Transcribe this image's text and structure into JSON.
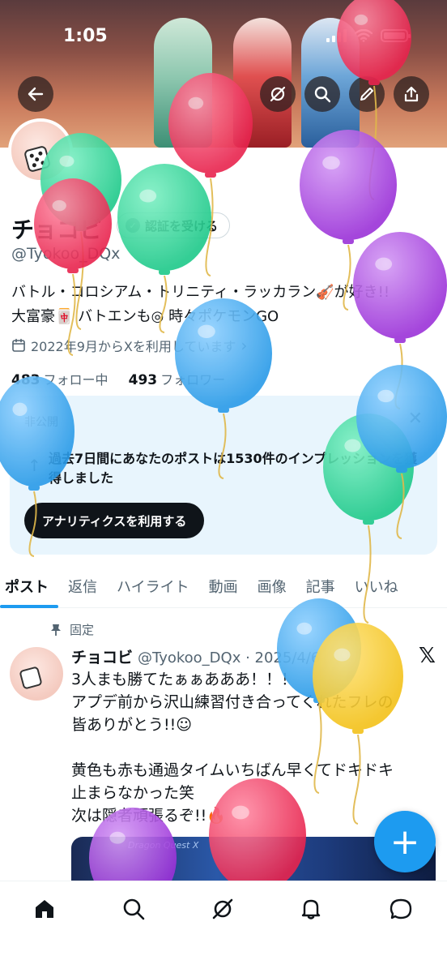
{
  "status_bar": {
    "time": "1:05"
  },
  "profile": {
    "name": "チョコビ",
    "verify_label": "認証を受ける",
    "handle": "@Tyokoo_DQx",
    "bio_line1": "バトル・コロシアム・トリニティ・ラッカラン🎻が好き!!",
    "bio_line2": "大富豪🀄 バトエンも◎ 時々ポケモンGO",
    "joined": "2022年9月からXを利用しています",
    "following_count": "483",
    "following_label": "フォロー中",
    "followers_count": "493",
    "followers_label": "フォロワー"
  },
  "analytics_card": {
    "private_label": "非公開",
    "message": "過去7日間にあなたのポストは1530件のインプレッションを獲得しました",
    "cta_label": "アナリティクスを利用する"
  },
  "tabs": [
    "ポスト",
    "返信",
    "ハイライト",
    "動画",
    "画像",
    "記事",
    "いいね"
  ],
  "tweet": {
    "pinned_label": "固定",
    "author": "チョコビ",
    "handle_date": "@Tyokoo_DQx · 2025/4/6",
    "line1": "3人まも勝てたぁぁあああ！！！",
    "line2": "アプデ前から沢山練習付き合ってくれたフレの",
    "line3": "皆ありがとう!!☺",
    "line4": "",
    "line5": "黄色も赤も通過タイムいちばん早くてドキドキ",
    "line6": "止まらなかった笑",
    "line7": "次は隠者頑張るぞ!!🔥",
    "media_title": "Dragon Quest X"
  },
  "icons": {
    "back": "back-arrow-icon",
    "grok": "grok-icon",
    "search": "search-icon",
    "edit": "edit-icon",
    "share": "share-icon",
    "calendar": "calendar-icon",
    "pin": "pin-icon",
    "x_logo": "x-logo-icon",
    "compose": "compose-plus-icon",
    "home": "home-icon",
    "explore": "search-icon",
    "grok_nav": "grok-icon",
    "notifications": "bell-icon",
    "messages": "chat-icon"
  },
  "colors": {
    "accent": "#1d9bf0",
    "text": "#0f1419",
    "secondary_text": "#536471",
    "card_bg": "#e8f5fd"
  }
}
